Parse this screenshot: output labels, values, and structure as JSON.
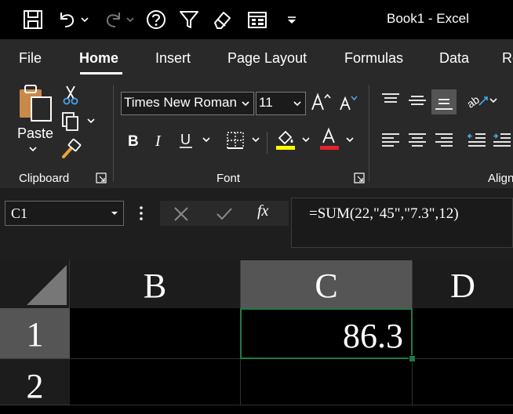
{
  "window": {
    "title": "Book1  -  Excel"
  },
  "ribbon_tabs": [
    {
      "label": "File"
    },
    {
      "label": "Home"
    },
    {
      "label": "Insert"
    },
    {
      "label": "Page Layout"
    },
    {
      "label": "Formulas"
    },
    {
      "label": "Data"
    },
    {
      "label": "Re"
    }
  ],
  "clipboard": {
    "paste_label": "Paste",
    "group_label": "Clipboard"
  },
  "font": {
    "family": "Times New Roman",
    "size": "11",
    "group_label": "Font"
  },
  "alignment": {
    "group_label": "Align"
  },
  "colors": {
    "highlight": "#ffff00",
    "font_color": "#e8222a",
    "active_cell_border": "#1f7a47"
  },
  "formula_bar": {
    "name_box": "C1",
    "formula": "=SUM(22,\"45\",\"7.3\",12)",
    "fx_label": "fx"
  },
  "grid": {
    "columns": [
      {
        "label": "B"
      },
      {
        "label": "C"
      },
      {
        "label": "D"
      }
    ],
    "rows": [
      {
        "label": "1"
      },
      {
        "label": "2"
      }
    ],
    "active_cell_value": "86.3"
  }
}
